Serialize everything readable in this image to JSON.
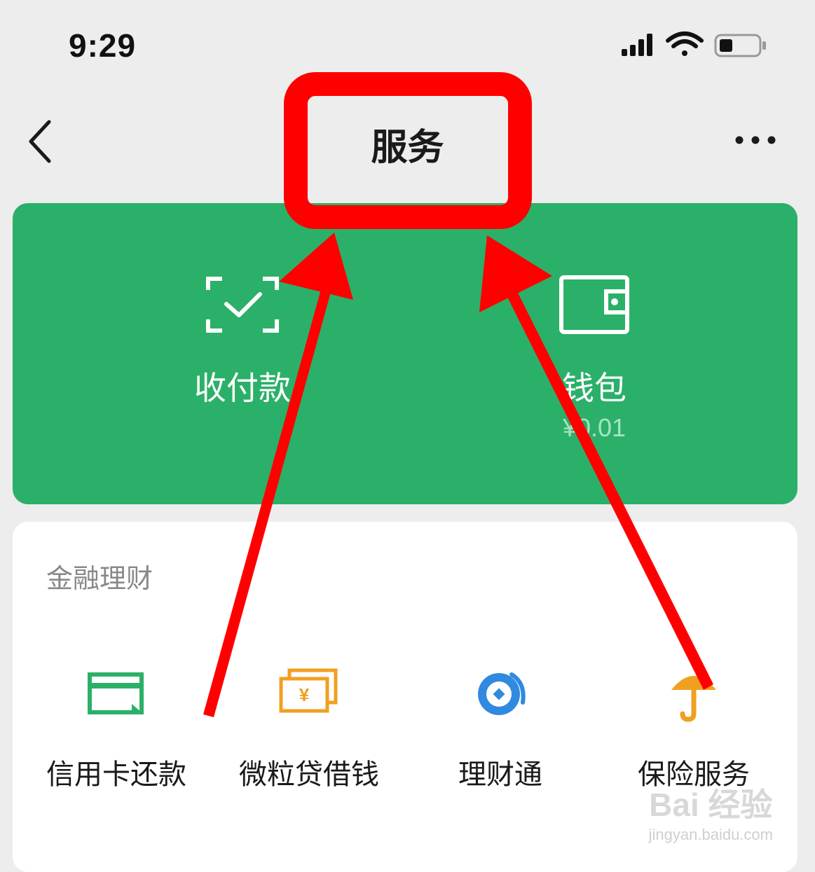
{
  "status_bar": {
    "time": "9:29",
    "icons": [
      "cellular-signal-icon",
      "wifi-icon",
      "battery-icon"
    ]
  },
  "nav": {
    "title": "服务",
    "back_icon": "chevron-left-icon",
    "more_icon": "more-dots-icon"
  },
  "header_card": {
    "color": "#2bb069",
    "items": [
      {
        "label": "收付款",
        "icon": "scan-check-icon"
      },
      {
        "label": "钱包",
        "sub": "¥0.01",
        "icon": "wallet-icon"
      }
    ]
  },
  "finance": {
    "title": "金融理财",
    "items": [
      {
        "label": "信用卡还款",
        "icon": "credit-card-icon",
        "color": "#2bb069"
      },
      {
        "label": "微粒贷借钱",
        "icon": "yuan-bills-icon",
        "color": "#f0a020"
      },
      {
        "label": "理财通",
        "icon": "licaitong-icon",
        "color": "#2f8ae0"
      },
      {
        "label": "保险服务",
        "icon": "umbrella-icon",
        "color": "#f0a020"
      }
    ]
  },
  "annotation": {
    "color": "#ff0000"
  },
  "watermark": {
    "logo": "Bai 经验",
    "url": "jingyan.baidu.com"
  }
}
